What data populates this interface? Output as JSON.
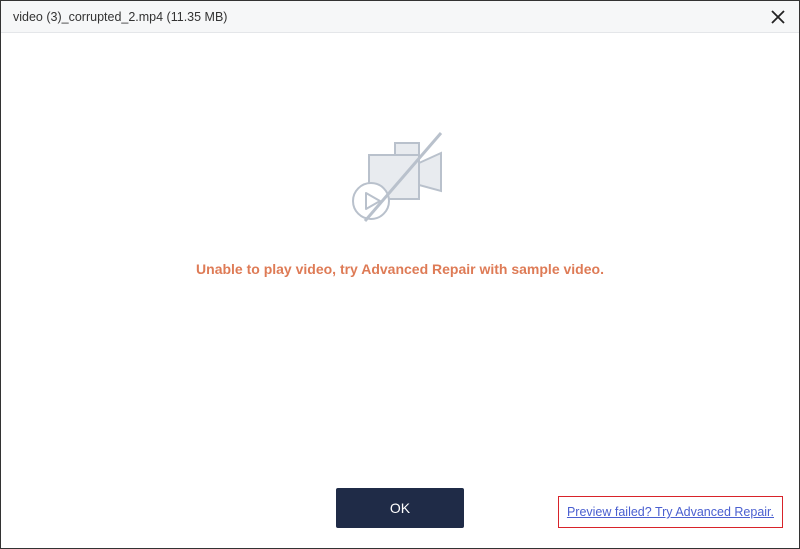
{
  "titlebar": {
    "title": "video (3)_corrupted_2.mp4 (11.35  MB)"
  },
  "error_message": "Unable to play video, try Advanced Repair with sample video.",
  "footer": {
    "ok_label": "OK",
    "advanced_link": "Preview failed? Try Advanced Repair."
  }
}
